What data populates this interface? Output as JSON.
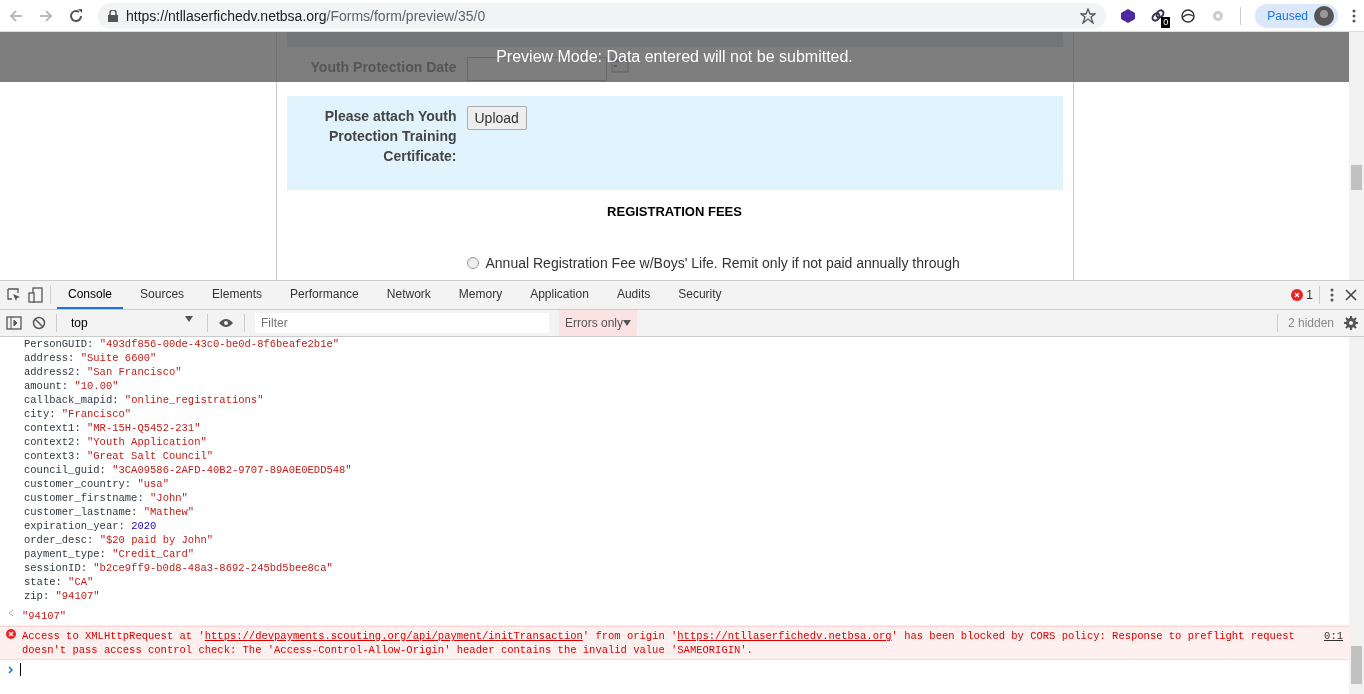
{
  "browser": {
    "url_host": "https://ntllaserfichedv.netbsa.org",
    "url_path": "/Forms/form/preview/35/0",
    "extension_badge": "0",
    "profile_status": "Paused"
  },
  "preview_banner": "Preview Mode: Data entered will not be submitted.",
  "form": {
    "fields": [
      {
        "kind": "date",
        "label": "Youth Protection Date",
        "highlighted": false
      },
      {
        "kind": "upload",
        "label": "Please attach Youth Protection Training Certificate:",
        "button": "Upload",
        "highlighted": true
      }
    ],
    "section_title": "REGISTRATION FEES",
    "options": [
      {
        "label": "Annual Registration Fee w/Boys' Life. Remit only if not paid annually through",
        "selected": false
      }
    ]
  },
  "devtools": {
    "tabs": [
      {
        "label": "Console",
        "selected": true
      },
      {
        "label": "Sources",
        "selected": false
      },
      {
        "label": "Elements",
        "selected": false
      },
      {
        "label": "Performance",
        "selected": false
      },
      {
        "label": "Network",
        "selected": false
      },
      {
        "label": "Memory",
        "selected": false
      },
      {
        "label": "Application",
        "selected": false
      },
      {
        "label": "Audits",
        "selected": false
      },
      {
        "label": "Security",
        "selected": false
      }
    ],
    "error_count": "1",
    "context": "top",
    "filter_placeholder": "Filter",
    "log_level": "Errors only",
    "hidden_count": "2 hidden"
  },
  "console": {
    "properties": [
      {
        "key": "PersonGUID:",
        "value": "\"493df856-00de-43c0-be0d-8f6beafe2b1e\"",
        "kind": "string"
      },
      {
        "key": "address:",
        "value": "\"Suite 6600\"",
        "kind": "string"
      },
      {
        "key": "address2:",
        "value": "\"San Francisco\"",
        "kind": "string"
      },
      {
        "key": "amount:",
        "value": "\"10.00\"",
        "kind": "string"
      },
      {
        "key": "callback_mapid:",
        "value": "\"online_registrations\"",
        "kind": "string"
      },
      {
        "key": "city:",
        "value": "\"Francisco\"",
        "kind": "string"
      },
      {
        "key": "context1:",
        "value": "\"MR-15H-Q5452-231\"",
        "kind": "string"
      },
      {
        "key": "context2:",
        "value": "\"Youth Application\"",
        "kind": "string"
      },
      {
        "key": "context3:",
        "value": "\"Great Salt Council\"",
        "kind": "string"
      },
      {
        "key": "council_guid:",
        "value": "\"3CA09586-2AFD-40B2-9707-89A0E0EDD548\"",
        "kind": "string"
      },
      {
        "key": "customer_country:",
        "value": "\"usa\"",
        "kind": "string"
      },
      {
        "key": "customer_firstname:",
        "value": "\"John\"",
        "kind": "string"
      },
      {
        "key": "customer_lastname:",
        "value": "\"Mathew\"",
        "kind": "string"
      },
      {
        "key": "expiration_year:",
        "value": "2020",
        "kind": "number"
      },
      {
        "key": "order_desc:",
        "value": "\"$20 paid by John\"",
        "kind": "string"
      },
      {
        "key": "payment_type:",
        "value": "\"Credit_Card\"",
        "kind": "string"
      },
      {
        "key": "sessionID:",
        "value": "\"b2ce9ff9-b0d8-48a3-8692-245bd5bee8ca\"",
        "kind": "string"
      },
      {
        "key": "state:",
        "value": "\"CA\"",
        "kind": "string"
      },
      {
        "key": "zip:",
        "value": "\"94107\"",
        "kind": "string"
      }
    ],
    "result": "\"94107\"",
    "error": {
      "segments": [
        {
          "kind": "text",
          "text": "Access to XMLHttpRequest at '"
        },
        {
          "kind": "link",
          "text": "https://devpayments.scouting.org/api/payment/initTransaction"
        },
        {
          "kind": "text",
          "text": "' from origin '"
        },
        {
          "kind": "link",
          "text": "https://ntllaserfichedv.netbsa.org"
        },
        {
          "kind": "text",
          "text": "' has been blocked by CORS policy: Response to preflight request doesn't pass access control check: The 'Access-Control-Allow-Origin' header contains the invalid value 'SAMEORIGIN'."
        }
      ],
      "location": "0:1"
    }
  }
}
